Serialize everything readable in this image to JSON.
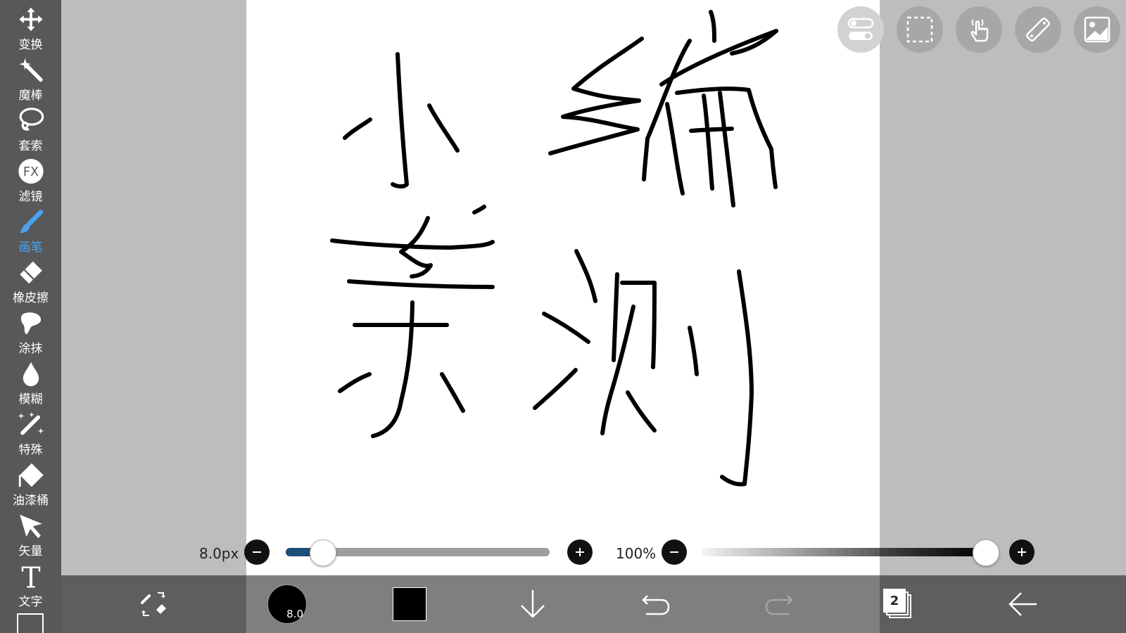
{
  "tools": [
    {
      "id": "transform",
      "label": "变换",
      "icon": "move-icon"
    },
    {
      "id": "magic-wand",
      "label": "魔棒",
      "icon": "magic-wand-icon"
    },
    {
      "id": "lasso",
      "label": "套索",
      "icon": "lasso-icon"
    },
    {
      "id": "filter",
      "label": "滤镜",
      "icon": "fx-icon",
      "icon_text": "FX"
    },
    {
      "id": "brush",
      "label": "画笔",
      "icon": "brush-icon",
      "active": true
    },
    {
      "id": "eraser",
      "label": "橡皮擦",
      "icon": "eraser-icon"
    },
    {
      "id": "smudge",
      "label": "涂抹",
      "icon": "smudge-icon"
    },
    {
      "id": "blur",
      "label": "模糊",
      "icon": "drop-icon"
    },
    {
      "id": "special",
      "label": "特殊",
      "icon": "sparkle-pen-icon"
    },
    {
      "id": "bucket",
      "label": "油漆桶",
      "icon": "bucket-icon"
    },
    {
      "id": "vector",
      "label": "矢量",
      "icon": "cursor-arrow-icon"
    },
    {
      "id": "text",
      "label": "文字",
      "icon": "text-icon",
      "icon_text": "T"
    }
  ],
  "colors": {
    "accent": "#4aa3f0",
    "toolbar_bg": "#585858",
    "bottom_bg": "#7f7f7f",
    "canvas": "#ffffff",
    "brush_color": "#000000"
  },
  "brush_size": {
    "label": "8.0px",
    "value": 8.0,
    "fraction": 0.1
  },
  "opacity": {
    "label": "100%",
    "fraction": 1.0
  },
  "bottom": {
    "brush_size_badge": "8.0",
    "layer_count": "2"
  }
}
